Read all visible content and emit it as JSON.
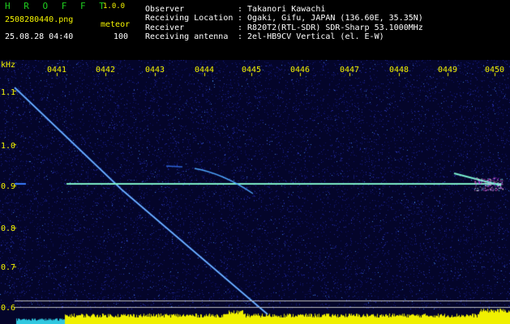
{
  "header": {
    "brand": "H R O F F T",
    "version": "1.0.0",
    "filename": "2508280440.png",
    "datetime": "25.08.28 04:40",
    "mode_label": "meteor",
    "mode_value": "100",
    "fields": [
      {
        "label": "Observer",
        "value": ": Takanori Kawachi"
      },
      {
        "label": "Receiving Location",
        "value": ": Ogaki, Gifu, JAPAN (136.60E, 35.35N)"
      },
      {
        "label": "Receiver",
        "value": ": R820T2(RTL-SDR) SDR-Sharp 53.1000MHz"
      },
      {
        "label": "Receiving antenna",
        "value": ": 2el-HB9CV Vertical (el. E-W)"
      }
    ]
  },
  "spectrogram": {
    "y_unit": "kHz",
    "x_ticks": [
      "0441",
      "0442",
      "0443",
      "0444",
      "0445",
      "0446",
      "0447",
      "0448",
      "0449",
      "0450"
    ],
    "y_ticks": [
      "1.1",
      "1.0",
      "0.9",
      "0.8",
      "0.7",
      "0.6"
    ],
    "ylim": [
      0.58,
      1.19
    ],
    "colors": {
      "background": "#0a0a3a",
      "trace": "#2b8cff",
      "carrier": "#60f0d0",
      "level": "#f0f000",
      "text": "#f4f400"
    }
  }
}
